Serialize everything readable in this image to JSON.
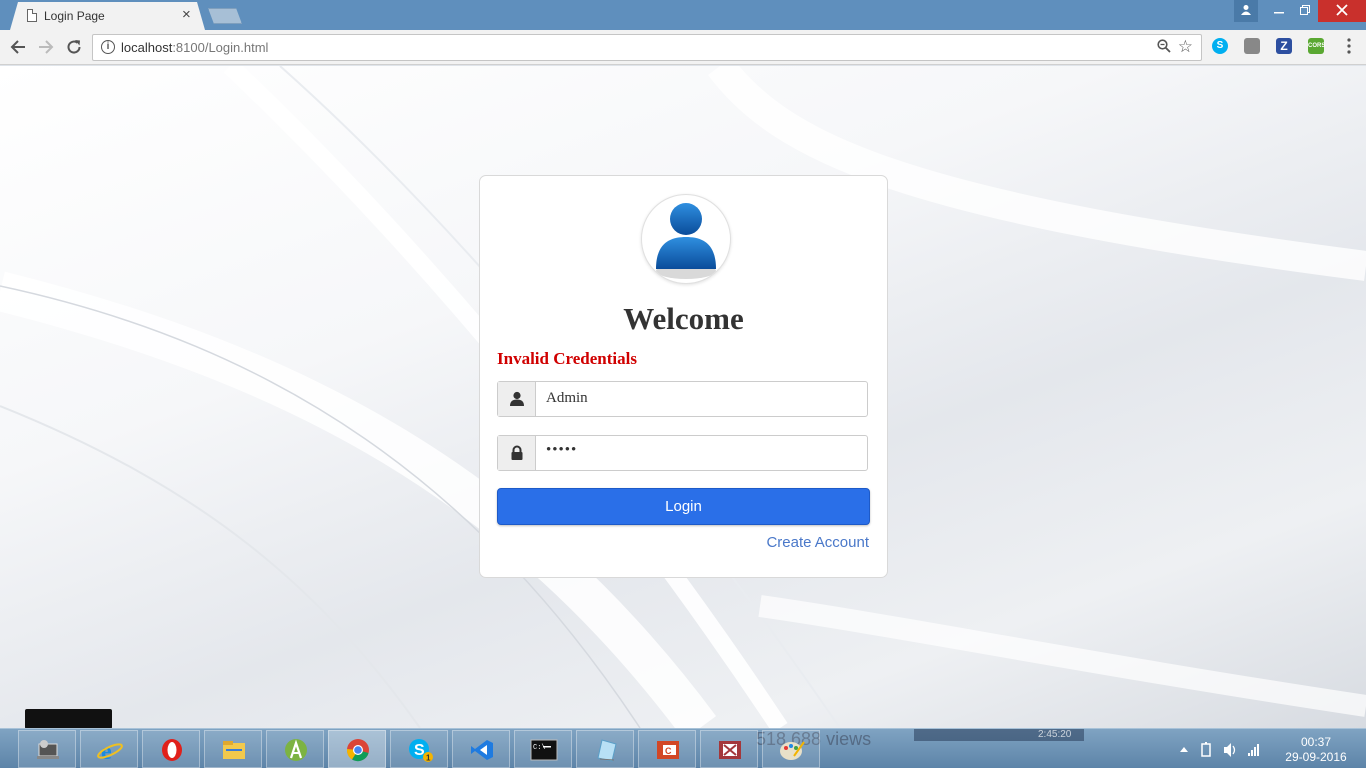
{
  "browser": {
    "tab_title": "Login Page",
    "tab_close": "×",
    "url_host": "localhost",
    "url_path": ":8100/Login.html",
    "extensions": [
      "skype-icon",
      "pocket-icon",
      "z-icon",
      "cors-icon"
    ],
    "ext_z_label": "Z",
    "ext_cors_label": "CORS"
  },
  "login": {
    "heading": "Welcome",
    "error": "Invalid Credentials",
    "username_value": "Admin",
    "password_value": "•••••",
    "submit_label": "Login",
    "create_account": "Create Account"
  },
  "colors": {
    "accent": "#2a6fe8",
    "error": "#d00000",
    "link": "#4a78c9"
  },
  "taskbar": {
    "apps": [
      "device-icon",
      "internet-explorer-icon",
      "opera-icon",
      "file-explorer-icon",
      "android-studio-icon",
      "chrome-icon",
      "skype-icon",
      "visual-studio-icon",
      "cmd-icon",
      "notepad-icon",
      "powerpoint-icon",
      "access-icon",
      "paint-icon"
    ],
    "active_app": "chrome-icon",
    "skype_badge": "1",
    "time": "00:37",
    "date": "29-09-2016",
    "background_text": "518,688 views",
    "background_time": "2:45:20"
  }
}
